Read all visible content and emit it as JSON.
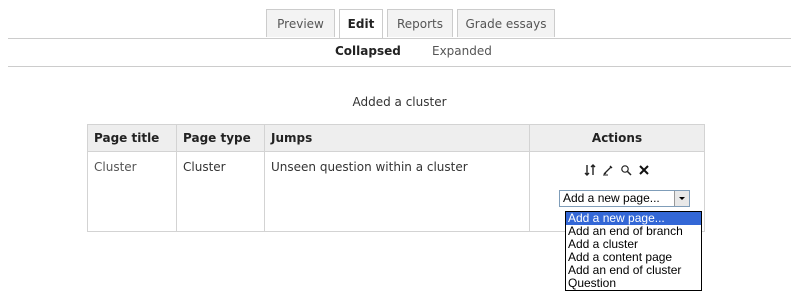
{
  "tabs": [
    "Preview",
    "Edit",
    "Reports",
    "Grade essays"
  ],
  "subtabs": [
    "Collapsed",
    "Expanded"
  ],
  "message": "Added a cluster",
  "table": {
    "headers": [
      "Page title",
      "Page type",
      "Jumps",
      "Actions"
    ],
    "row": {
      "title": "Cluster",
      "type": "Cluster",
      "jumps": "Unseen question within a cluster"
    }
  },
  "actions_icons": [
    "move-icon",
    "edit-icon",
    "preview-icon",
    "delete-icon"
  ],
  "select": {
    "value": "Add a new page...",
    "options": [
      "Add a new page...",
      "Add an end of branch",
      "Add a cluster",
      "Add a content page",
      "Add an end of cluster",
      "Question"
    ]
  }
}
